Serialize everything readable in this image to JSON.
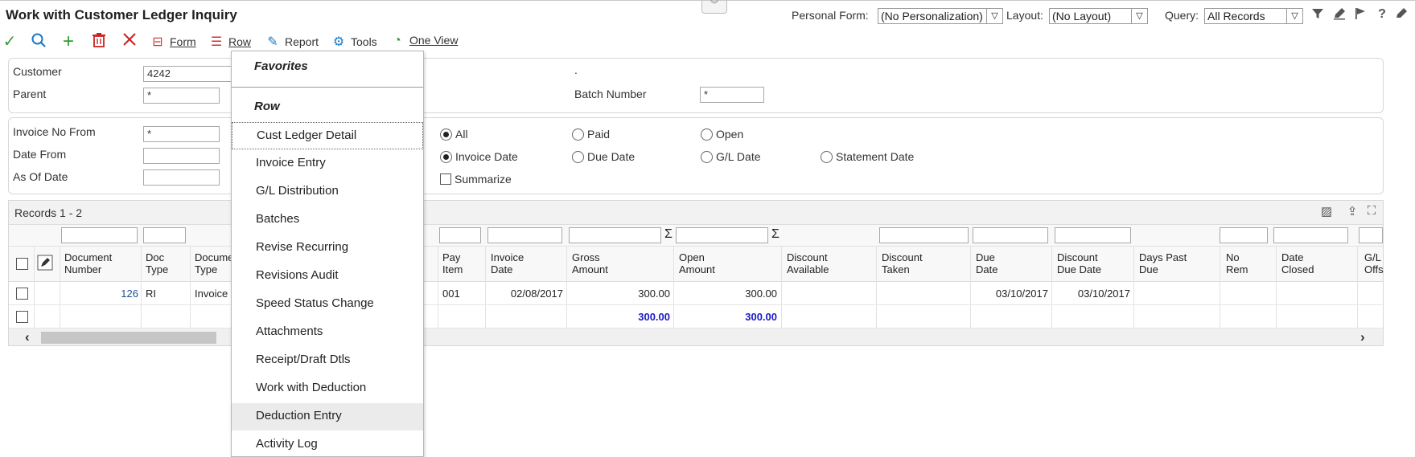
{
  "header": {
    "title": "Work with Customer Ledger Inquiry",
    "personal_form_label": "Personal Form:",
    "personal_form_value": "(No Personalization)",
    "layout_label": "Layout:",
    "layout_value": "(No Layout)",
    "query_label": "Query:",
    "query_value": "All Records"
  },
  "toolbar": {
    "form": "Form",
    "row": "Row",
    "report": "Report",
    "tools": "Tools",
    "one_view": "One View"
  },
  "filters": {
    "customer_label": "Customer",
    "customer_value": "4242",
    "parent_label": "Parent",
    "parent_value": "*",
    "batch_label": "Batch Number",
    "batch_value": "*",
    "batch_dot": ".",
    "invoice_from_label": "Invoice No From",
    "invoice_from_value": "*",
    "date_from_label": "Date From",
    "as_of_label": "As Of Date",
    "status": [
      "All",
      "Paid",
      "Open"
    ],
    "date_types": [
      "Invoice Date",
      "Due Date",
      "G/L Date",
      "Statement Date"
    ],
    "summarize": "Summarize"
  },
  "grid": {
    "records": "Records 1 - 2",
    "columns": {
      "doc_number": [
        "Document",
        "Number"
      ],
      "doc_type": [
        "Doc",
        "Type"
      ],
      "doc_type_desc": [
        "Docume",
        "Type"
      ],
      "pay_item": [
        "Pay",
        "Item"
      ],
      "invoice_date": [
        "Invoice",
        "Date"
      ],
      "gross": [
        "Gross",
        "Amount"
      ],
      "open": [
        "Open",
        "Amount"
      ],
      "disc_avail": [
        "Discount",
        "Available"
      ],
      "disc_taken": [
        "Discount",
        "Taken"
      ],
      "due_date": [
        "Due",
        "Date"
      ],
      "disc_due": [
        "Discount",
        "Due Date"
      ],
      "days_past": [
        "Days Past",
        "Due"
      ],
      "no_rem": [
        "No",
        "Rem"
      ],
      "date_closed": [
        "Date",
        "Closed"
      ],
      "gl_offset": [
        "G/L",
        "Offs"
      ]
    },
    "row1": {
      "doc_number": "126",
      "doc_type": "RI",
      "doc_type_desc": "Invoice",
      "pay_item": "001",
      "invoice_date": "02/08/2017",
      "gross": "300.00",
      "open": "300.00",
      "due_date": "03/10/2017",
      "disc_due": "03/10/2017"
    },
    "totals": {
      "gross": "300.00",
      "open": "300.00"
    }
  },
  "row_menu": {
    "favorites": "Favorites",
    "row_header": "Row",
    "items": [
      "Cust Ledger Detail",
      "Invoice Entry",
      "G/L Distribution",
      "Batches",
      "Revise Recurring",
      "Revisions Audit",
      "Speed Status Change",
      "Attachments",
      "Receipt/Draft Dtls",
      "Work with Deduction",
      "Deduction Entry",
      "Activity Log"
    ]
  },
  "colors": {
    "ok": "#3a9a3a",
    "add": "#2e9b2e",
    "delete": "#cc2222",
    "accent": "#1a7ac8",
    "total": "#1a1ac8"
  }
}
